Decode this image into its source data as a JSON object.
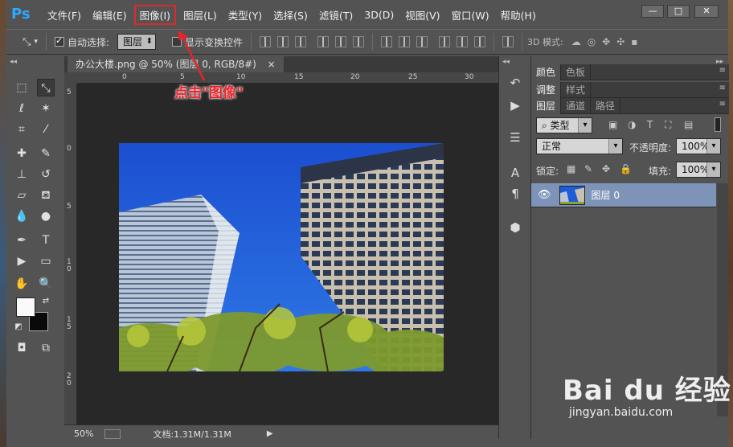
{
  "app": {
    "logo": "Ps",
    "menu": [
      "文件(F)",
      "编辑(E)",
      "图像(I)",
      "图层(L)",
      "类型(Y)",
      "选择(S)",
      "滤镜(T)",
      "3D(D)",
      "视图(V)",
      "窗口(W)",
      "帮助(H)"
    ],
    "highlighted_menu": "图像(I)",
    "window_controls": {
      "minimize": "—",
      "maximize": "□",
      "close": "✕"
    }
  },
  "options": {
    "auto_select_label": "自动选择:",
    "auto_select_checked": true,
    "auto_select_value": "图层",
    "show_transform_label": "显示变换控件",
    "show_transform_checked": false,
    "mode_3d_label": "3D 模式:"
  },
  "document": {
    "tab_title": "办公大楼.png @ 50% (图层 0, RGB/8#)",
    "tab_close": "×",
    "ruler_h_ticks": [
      "0",
      "5",
      "10",
      "15",
      "20",
      "25",
      "30"
    ],
    "ruler_v_ticks": [
      "5",
      "0",
      "5",
      "1\n0",
      "1\n5",
      "2\n0"
    ],
    "zoom": "50%",
    "doc_info": "文档:1.31M/1.31M"
  },
  "annotation": "点击\"图像\"",
  "panels": {
    "color_tabs": [
      "颜色",
      "色板"
    ],
    "adjust_tabs": [
      "调整",
      "样式"
    ],
    "layer_tabs": [
      "图层",
      "通道",
      "路径"
    ],
    "filter_kind": "类型",
    "blend_mode": "正常",
    "opacity_label": "不透明度:",
    "opacity_value": "100%",
    "lock_label": "锁定:",
    "fill_label": "填充:",
    "fill_value": "100%",
    "layer_name": "图层 0"
  },
  "watermark": {
    "main": "Bai du 经验",
    "sub": "jingyan.baidu.com"
  }
}
